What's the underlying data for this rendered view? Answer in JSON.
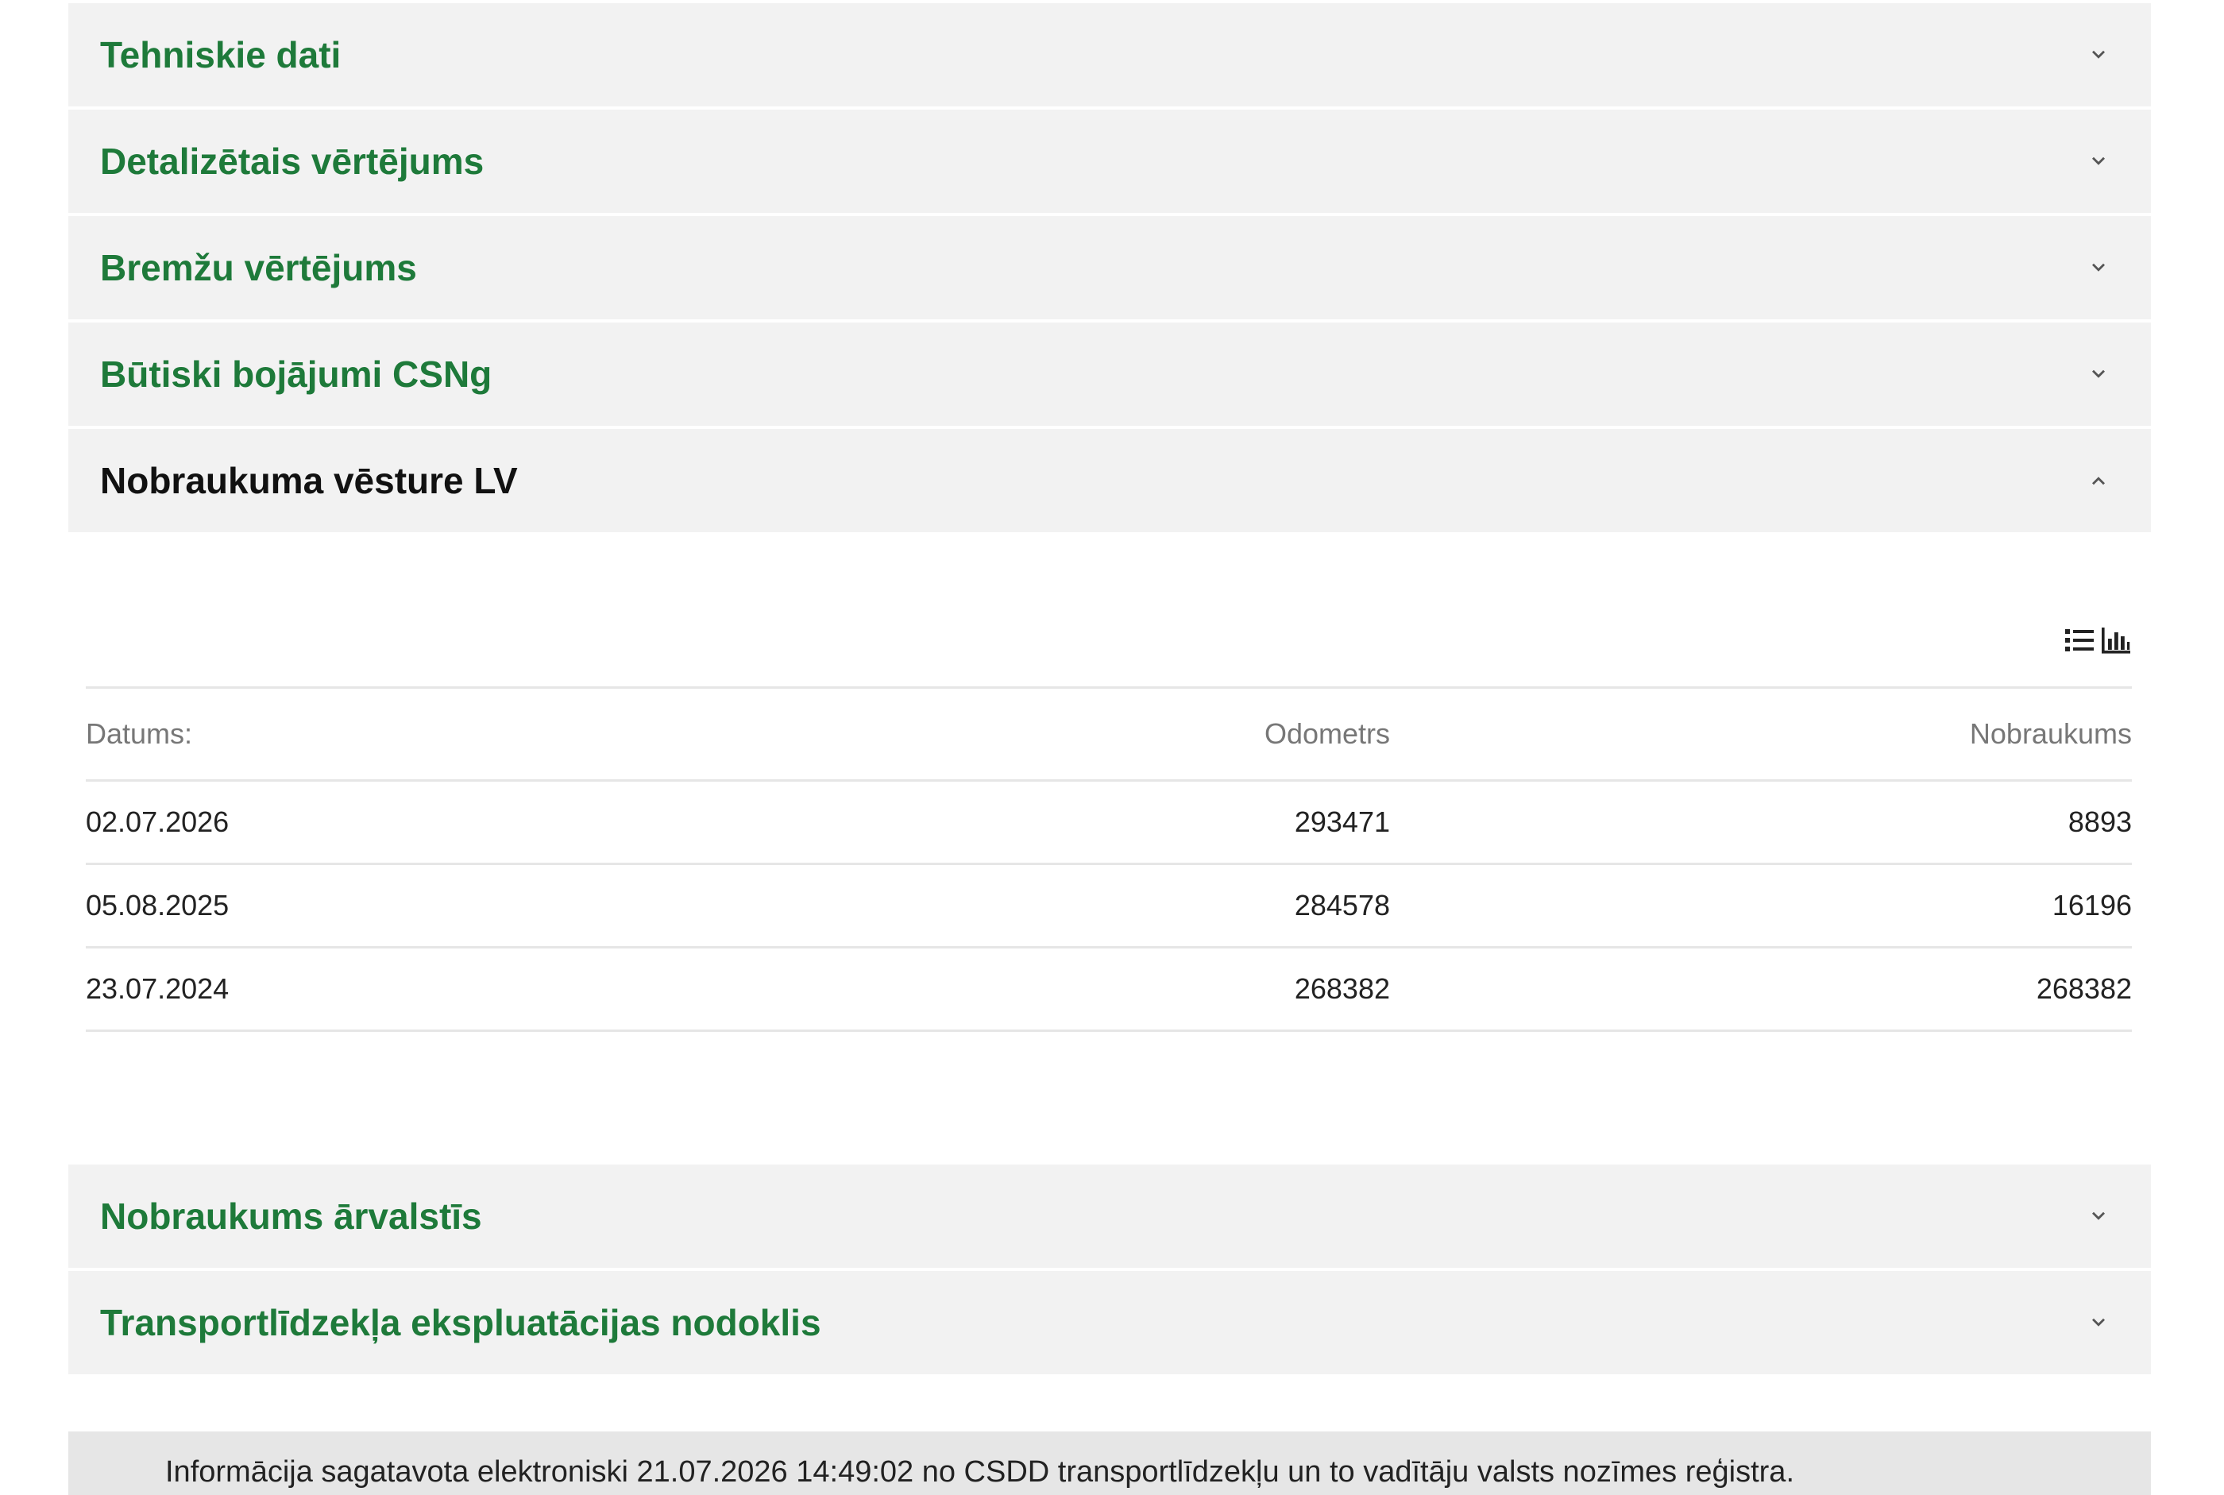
{
  "accordion_top": [
    {
      "title": "Tehniskie dati"
    },
    {
      "title": "Detalizētais vērtējums"
    },
    {
      "title": "Bremžu vērtējums"
    },
    {
      "title": "Būtiski bojājumi CSNg"
    }
  ],
  "open_section": {
    "title": "Nobraukuma vēsture LV"
  },
  "view_icons": [
    "list-view-icon",
    "chart-view-icon"
  ],
  "mileage_table": {
    "headers": [
      "Datums:",
      "Odometrs",
      "Nobraukums"
    ],
    "rows": [
      [
        "02.07.2026",
        "293471",
        "8893"
      ],
      [
        "05.08.2025",
        "284578",
        "16196"
      ],
      [
        "23.07.2024",
        "268382",
        "268382"
      ]
    ]
  },
  "accordion_bottom": [
    {
      "title": "Nobraukums ārvalstīs"
    },
    {
      "title": "Transportlīdzekļa ekspluatācijas nodoklis"
    }
  ],
  "footer_text": "Informācija sagatavota elektroniski 21.07.2026 14:49:02 no CSDD transportlīdzekļu un to vadītāju valsts nozīmes reģistra.",
  "colors": {
    "accent_green": "#1e7a3a",
    "header_bg": "#f2f2f2",
    "footer_bg": "#e6e6e6"
  }
}
